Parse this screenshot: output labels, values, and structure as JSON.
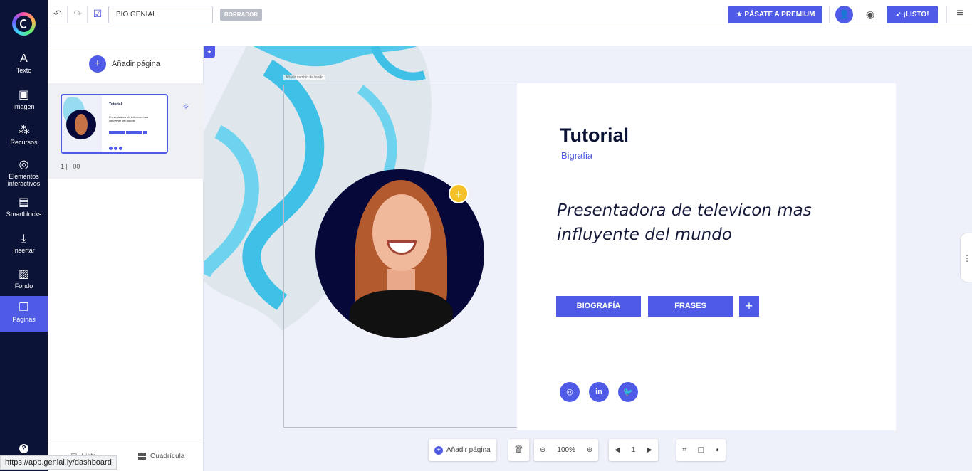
{
  "rail": {
    "items": [
      {
        "label": "Texto",
        "icon": "A"
      },
      {
        "label": "Imagen",
        "icon": "▣"
      },
      {
        "label": "Recursos",
        "icon": "⁂"
      },
      {
        "label": "Elementos interactivos",
        "icon": "◎"
      },
      {
        "label": "Smartblocks",
        "icon": "▤"
      },
      {
        "label": "Insertar",
        "icon": "⤓"
      },
      {
        "label": "Fondo",
        "icon": "▨"
      },
      {
        "label": "Páginas",
        "icon": "❐"
      }
    ],
    "help": "?"
  },
  "topbar": {
    "title_value": "BIO GENIAL",
    "draft_badge": "BORRADOR",
    "premium_label": "PÁSATE A PREMIUM",
    "ready_label": "¡LISTO!",
    "accent": "#4f5be6"
  },
  "panel": {
    "add_page": "Añadir página",
    "page_number": "1 |",
    "page_time": "00",
    "thumb_title": "Tutorial",
    "thumb_text": "Presentadora de televicon mas influyente del mundo",
    "tab_list": "Lista",
    "tab_grid": "Cuadrícula"
  },
  "slide": {
    "title": "Tutorial",
    "subtitle": "Bigrafia",
    "quote": "Presentadora de televicon mas influyente del mundo",
    "btn_bio": "BIOGRAFÍA",
    "btn_phrases": "FRASES",
    "btn_add": "+",
    "socials": [
      "instagram-icon",
      "linkedin-icon",
      "twitter-icon"
    ],
    "social_glyphs": [
      "◎",
      "in",
      "🐦"
    ],
    "background_hint": "Añadir cambio de fondo"
  },
  "bottombar": {
    "add_page": "Añadir página",
    "zoom": "100%",
    "page": "1"
  },
  "status_url": "https://app.genial.ly/dashboard"
}
